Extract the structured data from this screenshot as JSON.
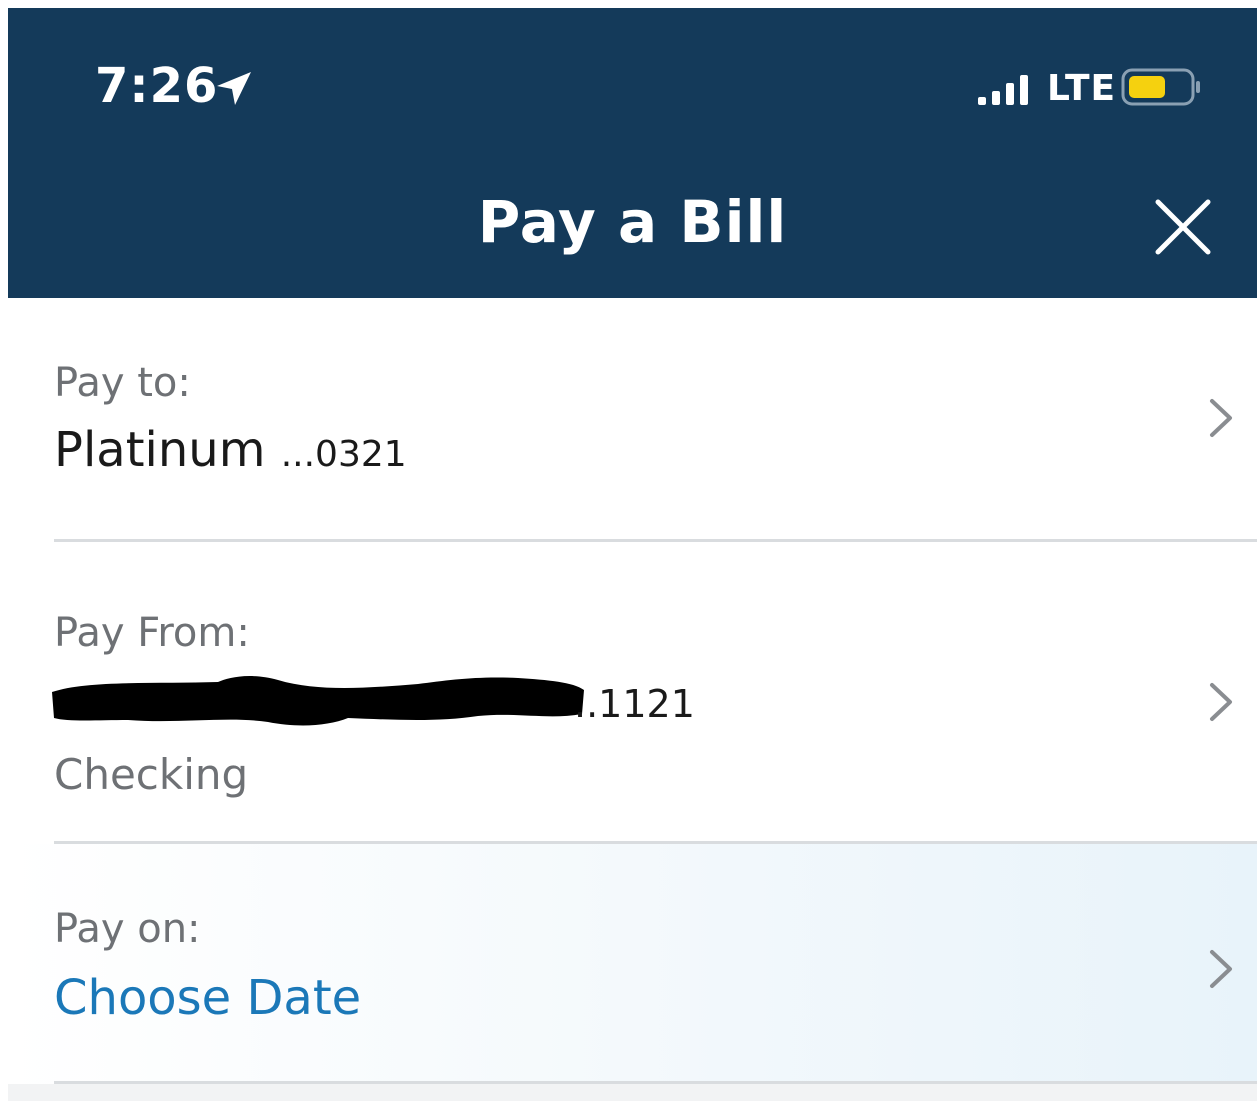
{
  "status_bar": {
    "time": "7:26",
    "network": "LTE",
    "battery_color": "#f5d10f"
  },
  "header": {
    "title": "Pay a Bill",
    "close_icon": "close-icon",
    "background_color": "#143a5a"
  },
  "pay_to": {
    "label": "Pay to:",
    "account_name": "Platinum",
    "account_suffix": "...0321"
  },
  "pay_from": {
    "label": "Pay From:",
    "account_suffix": "..1121",
    "account_type": "Checking"
  },
  "pay_on": {
    "label": "Pay on:",
    "value": "Choose Date",
    "value_color": "#1b78b8"
  }
}
